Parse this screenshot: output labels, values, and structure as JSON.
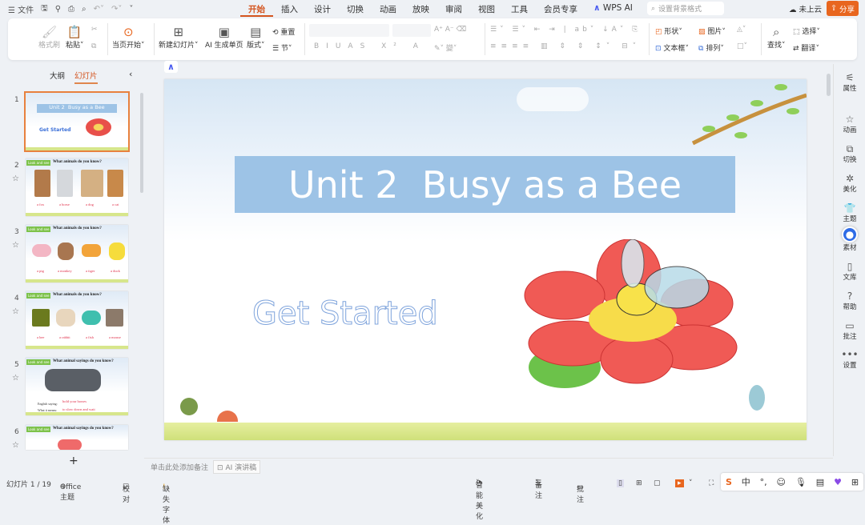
{
  "titlebar": {
    "menu_label": "文件",
    "tabs": [
      "开始",
      "插入",
      "设计",
      "切换",
      "动画",
      "放映",
      "审阅",
      "视图",
      "工具",
      "会员专享",
      "WPS AI"
    ],
    "active_tab": "开始",
    "search_placeholder": "设置背景格式",
    "cloud_label": "未上云",
    "share_label": "分享"
  },
  "ribbon": {
    "format_painter": "格式刷",
    "paste": "粘贴",
    "play_from_current": "当页开始",
    "new_slide": "新建幻灯片",
    "ai_single": "AI 生成单页",
    "layout": "版式",
    "reset": "重置",
    "section": "节",
    "shape": "形状",
    "picture": "图片",
    "textbox": "文本框",
    "arrange": "排列",
    "find": "查找",
    "select": "选择",
    "translate": "翻译"
  },
  "panel": {
    "tabs": [
      "大纲",
      "幻灯片"
    ],
    "active_tab": "幻灯片",
    "add_label": "+",
    "slides": [
      {
        "num": "1",
        "title": "Unit 2  Busy as a Bee",
        "subtitle": "Get Started"
      },
      {
        "num": "2",
        "tag": "Look and see",
        "question": "What animals do you know?",
        "labels": [
          "a fox",
          "a horse",
          "a dog",
          "a cat"
        ]
      },
      {
        "num": "3",
        "tag": "Look and see",
        "question": "What animals do you know?",
        "labels": [
          "a pig",
          "a monkey",
          "a tiger",
          "a duck"
        ]
      },
      {
        "num": "4",
        "tag": "Look and see",
        "question": "What animals do you know?",
        "labels": [
          "a bee",
          "a rabbit",
          "a fish",
          "a mouse"
        ]
      },
      {
        "num": "5",
        "tag": "Look and see",
        "question": "What animal sayings do you know?",
        "lines": [
          "English saying:",
          "hold your horses",
          "What it means:",
          "to slow down and wait"
        ]
      },
      {
        "num": "6",
        "tag": "Look and see",
        "question": "What animal sayings do you know?"
      }
    ]
  },
  "slide": {
    "title": "Unit 2  Busy as a Bee",
    "subtitle": "Get Started"
  },
  "notes": {
    "placeholder": "单击此处添加备注",
    "ai_script": "AI 演讲稿"
  },
  "status": {
    "slide_count": "幻灯片 1 / 19",
    "theme": "Office 主题",
    "proof": "校对",
    "missing_font": "缺失字体",
    "beautify": "智能美化",
    "notes": "备注",
    "comments": "批注"
  },
  "right_sidebar": [
    "属性",
    "动画",
    "切换",
    "美化",
    "主题",
    "素材",
    "文库",
    "帮助",
    "批注",
    "设置"
  ],
  "ime": {
    "mode": "中"
  },
  "colors": {
    "accent": "#d4541e",
    "banner": "#9dc3e6",
    "share": "#e8661f"
  }
}
